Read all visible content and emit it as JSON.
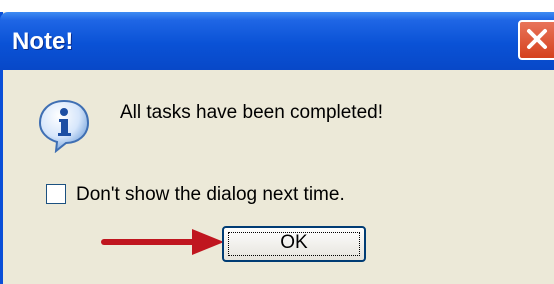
{
  "dialog": {
    "title": "Note!",
    "close_icon": "close-x-icon",
    "info_icon": "information-icon",
    "message": "All tasks have been completed!",
    "checkbox_label": "Don't show the dialog next time.",
    "checkbox_checked": false,
    "ok_label": "OK"
  },
  "annotation": {
    "arrow_icon": "red-arrow-icon",
    "arrow_color": "#c0161f"
  },
  "colors": {
    "titlebar": "#0a52d6",
    "dialog_bg": "#ece9d8",
    "close_button": "#d5411d"
  }
}
